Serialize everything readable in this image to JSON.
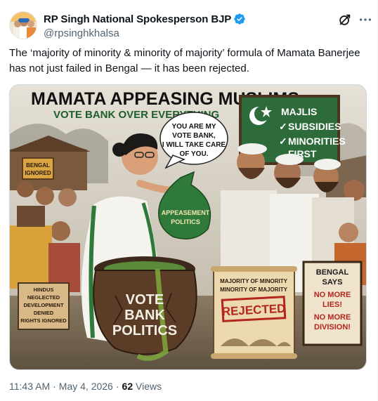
{
  "post": {
    "author": {
      "display_name": "RP Singh National Spokesperson BJP",
      "handle": "@rpsinghkhalsa",
      "verified_badge_color": "#1d9bf0"
    },
    "actions": {
      "grok_icon": "grok-icon",
      "more_icon": "more-horizontal-icon"
    },
    "text": "The ‘majority of minority & minority of majority’ formula of Mamata Banerjee has not just failed in Bengal — it has been rejected.",
    "image": {
      "headline": "MAMATA APPEASING MUSLIMS",
      "subheadline": "VOTE BANK OVER EVERYTHING",
      "speech_bubble": [
        "YOU ARE MY",
        "VOTE BANK,",
        "I WILL TAKE CARE",
        "OF YOU."
      ],
      "board_items": [
        "MAJLIS",
        "SUBSIDIES",
        "MINORITIES",
        "FIRST"
      ],
      "bag_label": [
        "APPEASEMENT",
        "POLITICS"
      ],
      "pot_label": [
        "VOTE",
        "BANK",
        "POLITICS"
      ],
      "bengal_sign": [
        "BENGAL",
        "IGNORED"
      ],
      "hindus_sign": [
        "HINDUS",
        "NEGLECTED",
        "DEVELOPMENT",
        "DENIED",
        "RIGHTS IGNORED"
      ],
      "scroll_text": [
        "MAJORITY OF MINORITY",
        "MINORITY OF MAJORITY"
      ],
      "scroll_stamp": "REJECTED",
      "right_sign": [
        "BENGAL",
        "SAYS",
        "NO MORE",
        "LIES!",
        "NO MORE",
        "DIVISION!"
      ]
    },
    "meta": {
      "time": "11:43 AM",
      "date": "May 4, 2026",
      "views_count": "62",
      "views_label": "Views"
    }
  }
}
